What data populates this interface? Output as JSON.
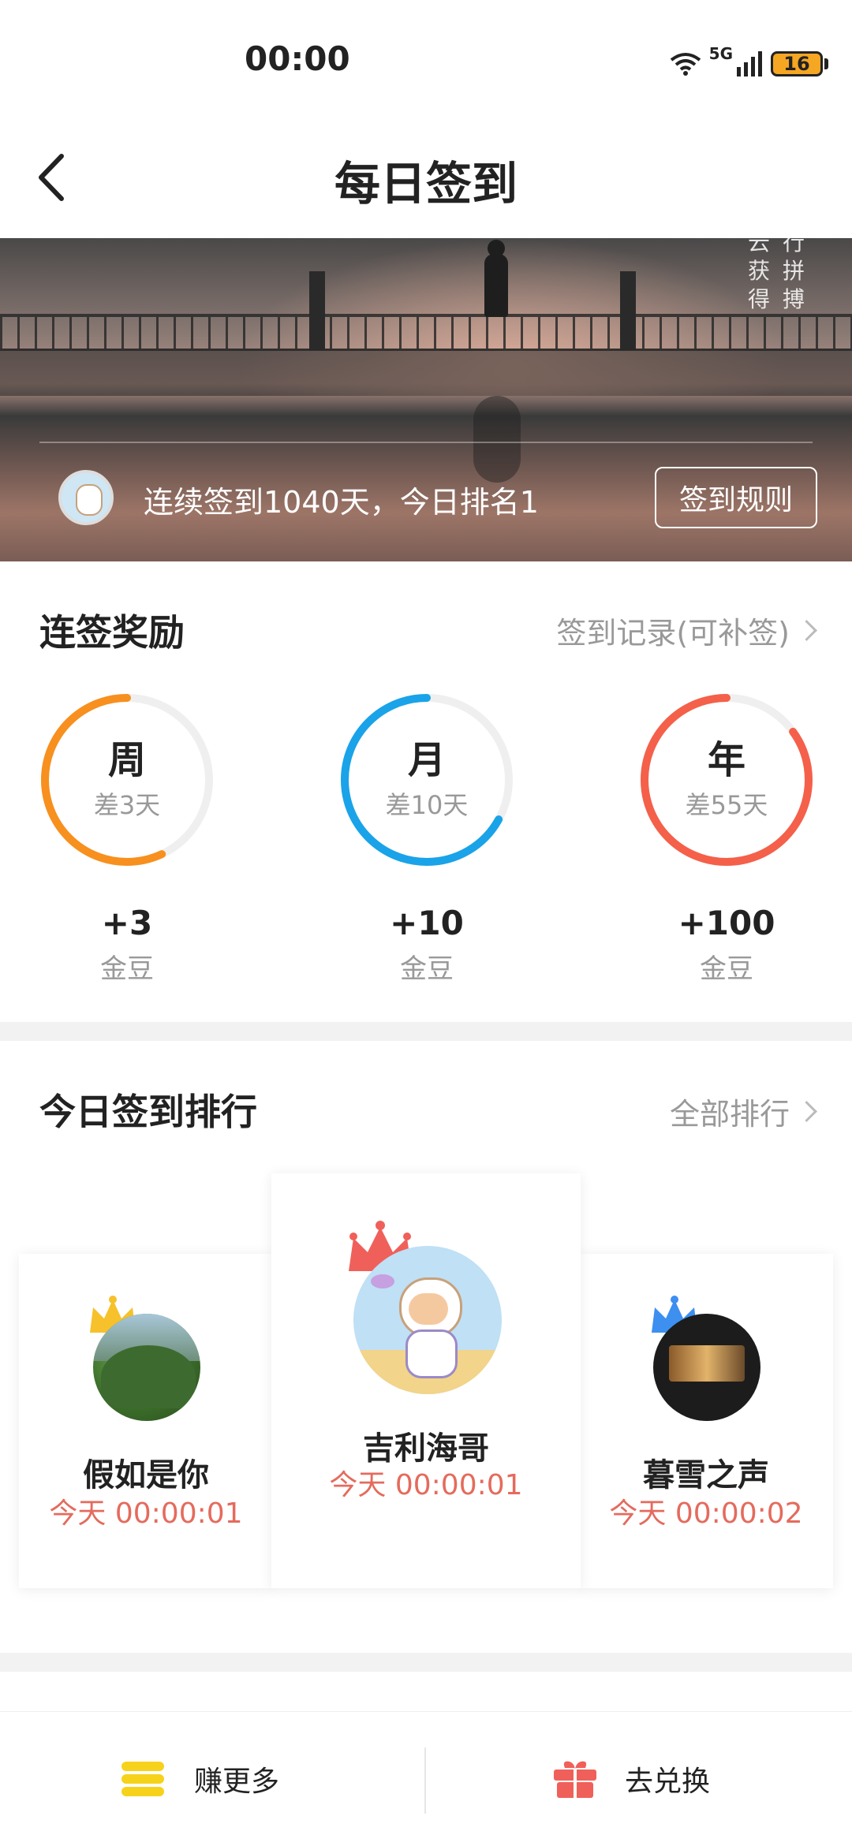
{
  "status_bar": {
    "time": "00:00",
    "network": "5G",
    "battery": "16"
  },
  "header": {
    "title": "每日签到",
    "back_icon": "chevron-left-icon"
  },
  "banner": {
    "corner_text_col1": [
      "云",
      "获",
      "得"
    ],
    "corner_text_col2": [
      "行",
      "拼",
      "搏"
    ],
    "streak_text": "连续签到1040天，今日排名1",
    "rules_button": "签到规则"
  },
  "streak_rewards": {
    "title": "连签奖励",
    "link": "签到记录(可补签)",
    "items": [
      {
        "period": "周",
        "remaining": "差3天",
        "amount": "+3",
        "unit": "金豆",
        "color": "#f7901e",
        "progress": 0.57
      },
      {
        "period": "月",
        "remaining": "差10天",
        "amount": "+10",
        "unit": "金豆",
        "color": "#1aa3e8",
        "progress": 0.67
      },
      {
        "period": "年",
        "remaining": "差55天",
        "amount": "+100",
        "unit": "金豆",
        "color": "#f4604a",
        "progress": 0.85
      }
    ]
  },
  "ranking": {
    "title": "今日签到排行",
    "link": "全部排行",
    "entries": [
      {
        "rank": 2,
        "name": "假如是你",
        "time": "今天 00:00:01",
        "crown_color": "#f6c12b"
      },
      {
        "rank": 1,
        "name": "吉利海哥",
        "time": "今天 00:00:01",
        "crown_color": "#f0605a"
      },
      {
        "rank": 3,
        "name": "暮雪之声",
        "time": "今天 00:00:02",
        "crown_color": "#3d8ff0"
      }
    ]
  },
  "bottom_bar": {
    "earn_label": "赚更多",
    "redeem_label": "去兑换"
  },
  "colors": {
    "accent_text": "#e46b5d",
    "coin": "#f7d21b",
    "gift": "#f0605a"
  }
}
